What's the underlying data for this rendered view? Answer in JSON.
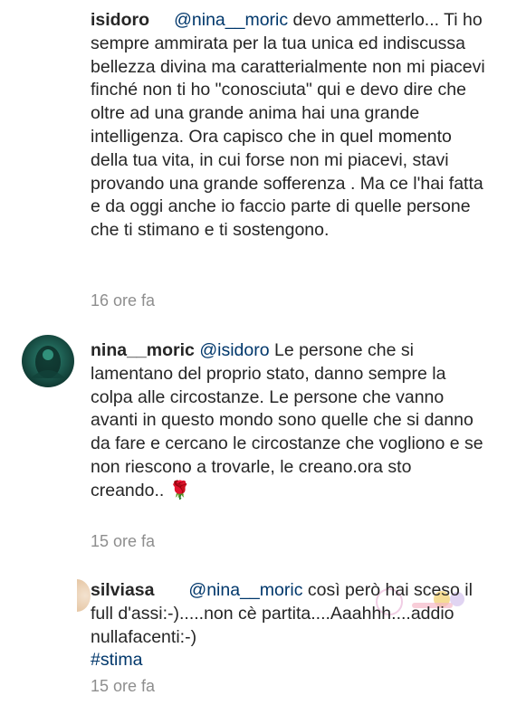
{
  "comments": [
    {
      "username": "isidoro",
      "mention": "@nina__moric",
      "text_after_mention": " devo ammetterlo... Ti ho sempre ammirata per la tua unica ed indiscussa bellezza divina ma caratterialmente non mi piacevi finché non ti ho \"conosciuta\" qui e devo dire che oltre ad una grande anima hai una grande intelligenza. Ora capisco che in quel momento della tua vita, in cui forse non mi piacevi, stavi provando una grande sofferenza . Ma ce l'hai fatta e da oggi anche io faccio parte di quelle persone che ti stimano e ti sostengono.",
      "time": "16 ore fa"
    },
    {
      "username": "nina__moric",
      "mention": "@isidoro",
      "text_after_mention": "    Le persone che si lamentano del proprio stato, danno sempre la colpa alle circostanze. Le persone che vanno avanti in questo mondo sono quelle che si danno da fare e cercano le circostanze che vogliono e se non riescono a trovarle, le creano.ora sto creando.. ",
      "emoji": "🌹",
      "time": "15 ore fa"
    },
    {
      "username": "silviasa",
      "mention": "@nina__moric",
      "text_after_mention": " così però hai sceso il full d'assi:-).....non cè partita....Aaahhh....addio nullafacenti:-)",
      "hashtag": "#stima",
      "time": "15 ore fa"
    }
  ],
  "icons": {
    "avatar_2": "avatar-image",
    "avatar_3": "avatar-image",
    "sticker": "cartoon-sticker"
  }
}
